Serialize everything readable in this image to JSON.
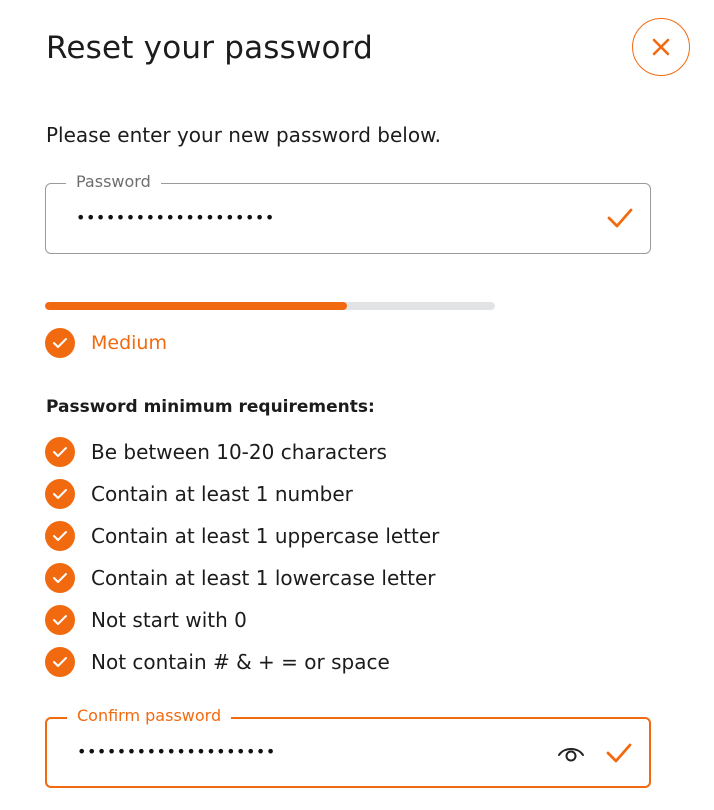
{
  "header": {
    "title": "Reset your password"
  },
  "intro": "Please enter your new password below.",
  "password_field": {
    "label": "Password",
    "value": "••••••••••••••••••••",
    "status_icon": "check-icon"
  },
  "strength": {
    "percent": 67,
    "label": "Medium"
  },
  "requirements": {
    "heading": "Password minimum requirements:",
    "items": [
      "Be between 10-20 characters",
      "Contain at least 1 number",
      "Contain at least 1 uppercase letter",
      "Contain at least 1 lowercase letter",
      "Not start with 0",
      "Not contain # & + = or space"
    ]
  },
  "confirm_field": {
    "label": "Confirm password",
    "value": "••••••••••••••••••••",
    "reveal_icon": "eye-icon",
    "status_icon": "check-icon"
  },
  "colors": {
    "accent": "#f26a10",
    "track": "#e2e3e5",
    "text": "#1c1c1c"
  }
}
